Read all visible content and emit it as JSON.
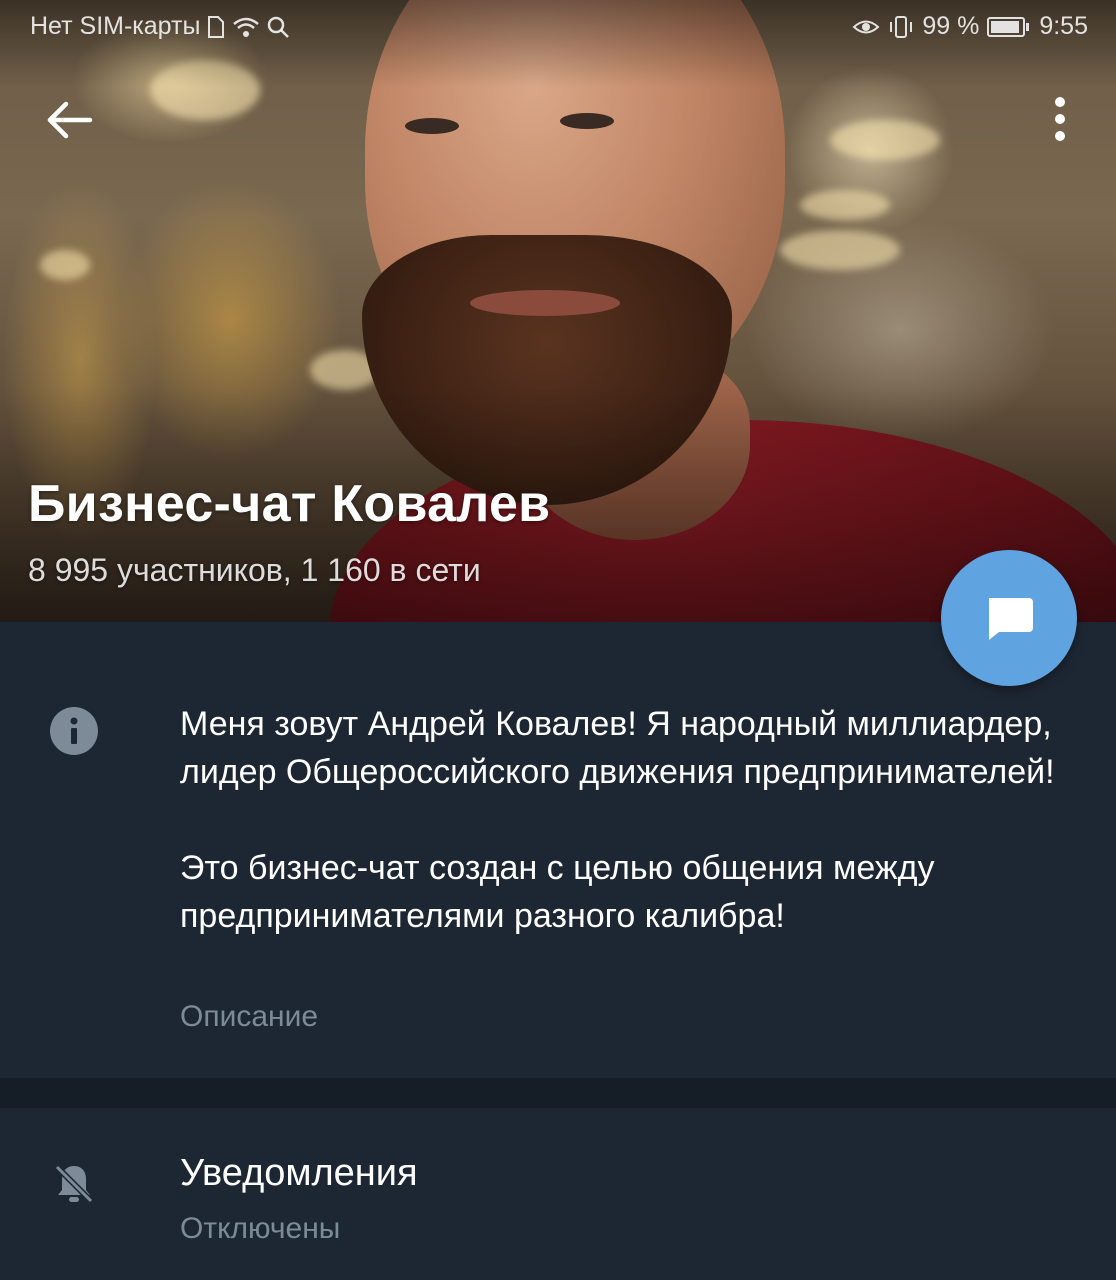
{
  "status_bar": {
    "carrier": "Нет SIM-карты",
    "battery": "99 %",
    "time": "9:55"
  },
  "header": {
    "title": "Бизнес-чат Ковалев",
    "subtitle": "8 995 участников, 1 160 в сети"
  },
  "info": {
    "description_paragraphs": [
      "Меня зовут Андрей Ковалев! Я народный миллиардер, лидер Общероссийского движения предпринимателей!",
      "Это бизнес-чат создан с целью общения между предпринимателями разного калибра!"
    ],
    "description_label": "Описание"
  },
  "notifications": {
    "title": "Уведомления",
    "value": "Отключены"
  },
  "colors": {
    "background": "#1d2733",
    "divider": "#151e27",
    "accent_fab": "#5fa3e0",
    "secondary_text": "#7d8b99"
  },
  "icons": {
    "back": "arrow-left-icon",
    "more": "more-vertical-icon",
    "fab": "chat-bubble-icon",
    "info": "info-icon",
    "notifications": "bell-off-icon",
    "status": [
      "sim-icon",
      "wifi-icon",
      "search-icon",
      "eye-icon",
      "vibrate-icon",
      "battery-icon"
    ]
  }
}
